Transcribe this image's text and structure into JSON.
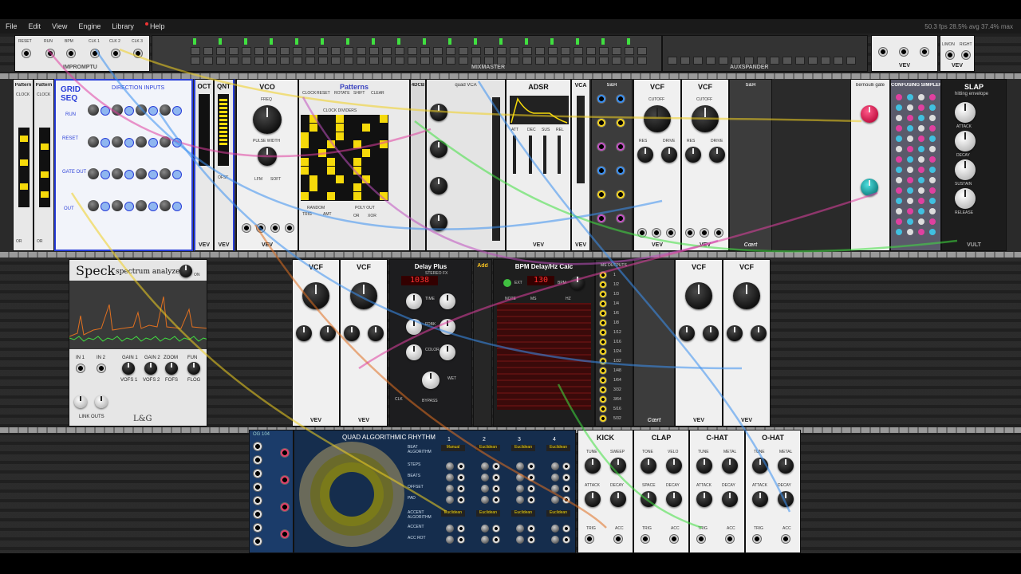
{
  "menu": [
    "File",
    "Edit",
    "View",
    "Engine",
    "Library",
    "Help"
  ],
  "stats": "50.3 fps  28.5% avg  37.4% max",
  "colors": {
    "rack_bg": "#2a2a2a",
    "accent_yellow": "#f5d90a",
    "led_red": "#ff3030"
  },
  "row0": {
    "impromptu": {
      "title": "IMPROMPTU",
      "labels": [
        "RESET",
        "RUN",
        "BPM",
        "CLK 1",
        "CLK 2",
        "CLK 3"
      ]
    },
    "mixmaster": {
      "title": "MIXMASTER"
    },
    "auxspander": {
      "title": "AUXSPANDER"
    },
    "right_small": {
      "vev": "VEV",
      "labels": [
        "L/MON",
        "RIGHT"
      ]
    }
  },
  "row1": {
    "pattern1": {
      "title": "Pattern",
      "labels": [
        "CLOCK",
        "RESET",
        "OR",
        "DR"
      ]
    },
    "pattern2": {
      "title": "Pattern",
      "labels": [
        "CLOCK",
        "RESET",
        "OR",
        "DR"
      ]
    },
    "gridseq": {
      "title": "GRID SEQ",
      "direction": "DIRECTION INPUTS",
      "labels": [
        "RUN",
        "RESET",
        "GATE OUT",
        "OUT",
        "RND",
        "REP"
      ]
    },
    "oct": {
      "title": "OCT",
      "vev": "VEV"
    },
    "qnt": {
      "title": "QNT",
      "labels": [
        "OFST"
      ],
      "vev": "VEV"
    },
    "vco": {
      "title": "VCO",
      "labels": [
        "FREQ",
        "PULSE WIDTH",
        "LFM",
        "SOFT",
        "FM",
        "V/OCT",
        "SYNC",
        "PWM",
        "SIN",
        "TRI",
        "SAW",
        "SQR"
      ],
      "vev": "VEV"
    },
    "patterns": {
      "title": "Patterns",
      "labels": [
        "CLOCK",
        "RESET",
        "ROTATE",
        "SHIFT",
        "CLEAR",
        "CLOCK DIVIDERS",
        "RANDOM",
        "TRIG",
        "AMT",
        "POLY OUT",
        "OR",
        "XOR"
      ]
    },
    "quadvca": {
      "title": "quad VCA",
      "brand": "4DCB",
      "labels": [
        "IN",
        "OUT",
        "CV"
      ]
    },
    "adsr": {
      "title": "ADSR",
      "labels": [
        "ATT",
        "DEC",
        "SUS",
        "REL"
      ],
      "vev": "VEV"
    },
    "vca": {
      "title": "VCA",
      "vev": "VEV"
    },
    "sh1": {
      "title": "S&H",
      "labels": [
        "Gate In",
        "In",
        "Out"
      ]
    },
    "vcf1": {
      "title": "VCF",
      "labels": [
        "CUTOFF",
        "RES",
        "DRIVE",
        "CUT",
        "RES",
        "DRIVE",
        "IN",
        "LPF",
        "HPF"
      ],
      "vev": "VEV"
    },
    "vcf2": {
      "title": "VCF",
      "labels": [
        "CUTOFF",
        "RES",
        "DRIVE",
        "IN",
        "LPF",
        "HPF"
      ],
      "vev": "VEV"
    },
    "sh2": {
      "title": "S&H",
      "brand": "Cœrt"
    },
    "bernoulli": {
      "title": "bernoulli gate",
      "labels": [
        "IN",
        "OUT A",
        "OUT B"
      ]
    },
    "simpler": {
      "title": "CONFUSING SIMPLER",
      "labels": [
        "OUT L",
        "OUT R"
      ]
    },
    "slap": {
      "title": "SLAP",
      "subtitle": "hitting envelope",
      "labels": [
        "ATTACK",
        "DECAY",
        "SUSTAIN",
        "RELEASE",
        "GATE",
        "OUT",
        "VCA"
      ],
      "brand": "VULT"
    }
  },
  "row2": {
    "speck": {
      "title": "Speck",
      "subtitle": "spectrum analyzer",
      "on": "ON",
      "labels": [
        "IN 1",
        "IN 2",
        "GAIN 1",
        "GAIN 2",
        "ZOOM",
        "FUN",
        "VOFS 1",
        "VOFS 2",
        "FOFS",
        "FLOG"
      ],
      "links": "LINK OUTS",
      "brand": "L&G"
    },
    "vcf3": {
      "title": "VCF",
      "vev": "VEV"
    },
    "vcf4": {
      "title": "VCF",
      "vev": "VEV"
    },
    "delay": {
      "title": "Delay Plus",
      "subtitle": "STEREO FX",
      "display": "1038",
      "labels": [
        "TIME",
        "FDBK",
        "COLOR",
        "WET",
        "CLK",
        "BYPASS",
        "MIX"
      ]
    },
    "add": {
      "title": "Add"
    },
    "bpmcalc": {
      "title": "BPM Delay/Hz Calc",
      "display": "130",
      "labels": [
        "EXT",
        "BPM",
        "NOTE",
        "MS",
        "HZ"
      ]
    },
    "msoutputs": {
      "title": "MS OUTPUTS",
      "labels": [
        "1",
        "1/2",
        "1/3",
        "1/4",
        "1/6",
        "1/8",
        "1/12",
        "1/16",
        "1/24",
        "1/32",
        "1/48",
        "1/64",
        "3/32",
        "3/64",
        "5/16",
        "5/32"
      ]
    },
    "sh3": {
      "title": "S&H",
      "brand": "Cœrt"
    },
    "vcf5": {
      "title": "VCF",
      "vev": "VEV"
    },
    "vcf6": {
      "title": "VCF",
      "vev": "VEV"
    }
  },
  "row3": {
    "qd": {
      "title": "OG 104"
    },
    "qar": {
      "title": "QUAD ALGORITHMIC RHYTHM",
      "cols": [
        "1",
        "2",
        "3",
        "4"
      ],
      "rows": [
        "BEAT ALGORITHM",
        "STEPS",
        "BEATS",
        "OFFSET",
        "PAD",
        "ACCENT ALGORITHM",
        "ACCENT",
        "ACC ROT"
      ],
      "algos": [
        "Manual",
        "Euclidean",
        "Euclidean",
        "Euclidean"
      ]
    },
    "kick": {
      "title": "KICK",
      "labels": [
        "TUNE",
        "SWEEP",
        "ATTACK",
        "DECAY",
        "TRIG",
        "ACC"
      ]
    },
    "clap": {
      "title": "CLAP",
      "labels": [
        "TONE",
        "VELO",
        "SPACE",
        "DECAY",
        "TRIG",
        "ACC"
      ]
    },
    "chat": {
      "title": "C-HAT",
      "labels": [
        "TUNE",
        "METAL",
        "ATTACK",
        "DECAY",
        "TRIG",
        "ACC"
      ]
    },
    "ohat": {
      "title": "O-HAT",
      "labels": [
        "TUNE",
        "METAL",
        "ATTACK",
        "DECAY",
        "TRIG",
        "ACC"
      ]
    }
  }
}
